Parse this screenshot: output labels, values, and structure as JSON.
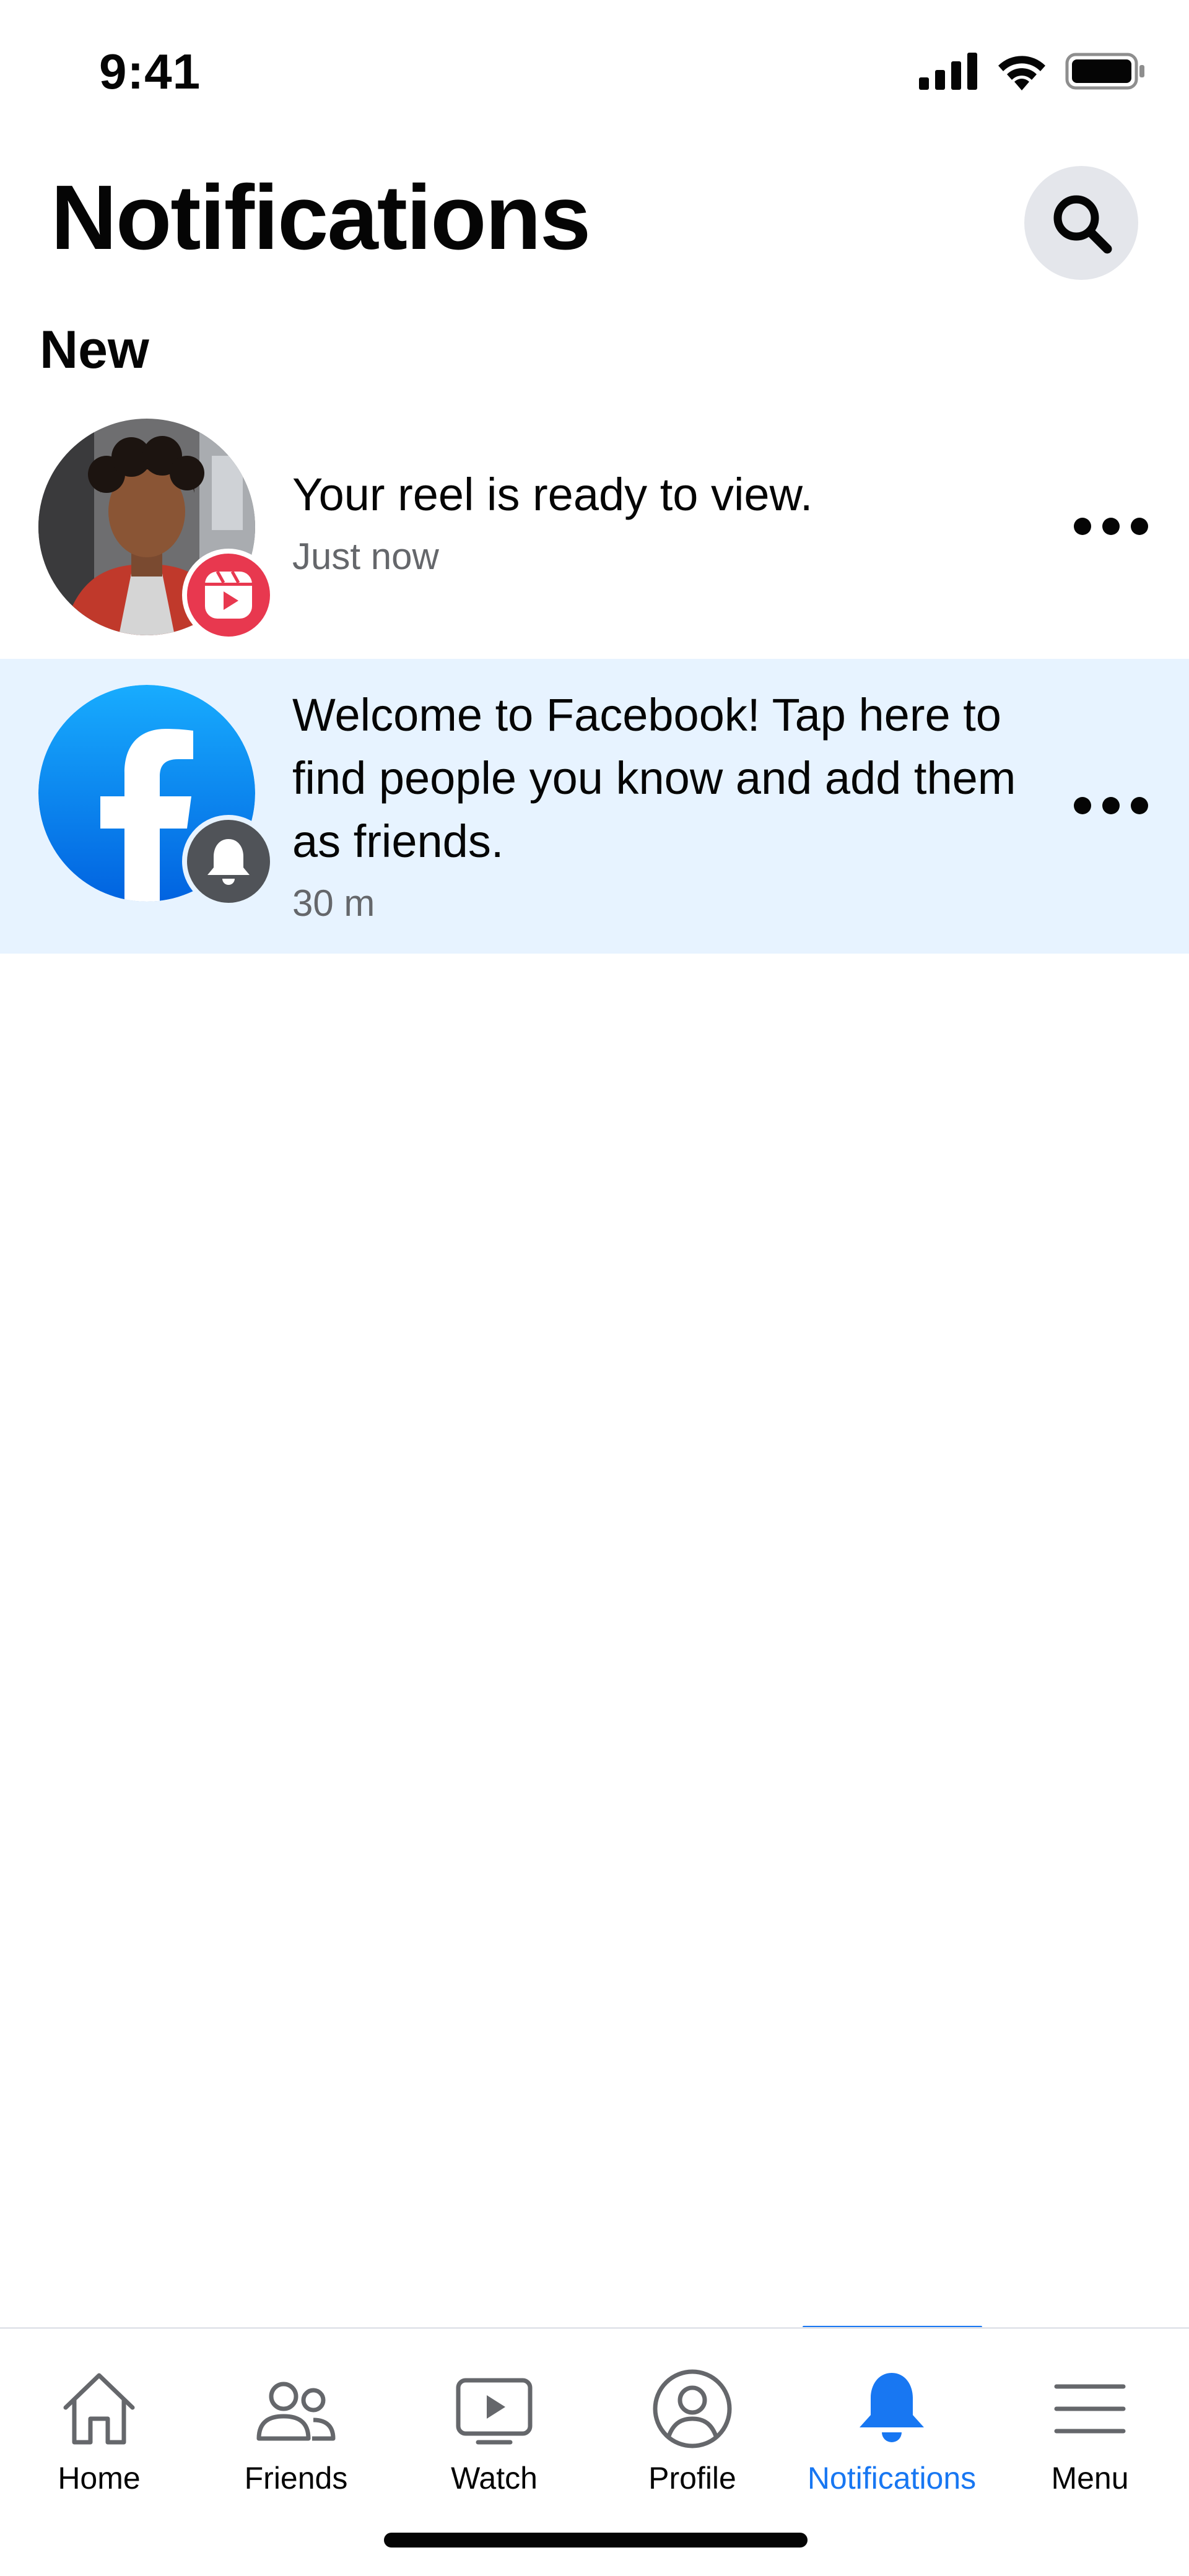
{
  "status_bar": {
    "time": "9:41"
  },
  "header": {
    "title": "Notifications"
  },
  "section": {
    "label": "New"
  },
  "notifications": [
    {
      "message": "Your reel is ready to view.",
      "time": "Just now",
      "avatar": "profile-photo",
      "badge": "reels-icon",
      "badge_color": "#e8384f",
      "unread": false
    },
    {
      "message": "Welcome to Facebook! Tap here to find people you know and add them as friends.",
      "time": "30 m",
      "avatar": "facebook-logo",
      "badge": "bell-icon",
      "badge_color": "#505358",
      "unread": true,
      "background": "#e7f3ff"
    }
  ],
  "tabs": [
    {
      "label": "Home",
      "icon": "home-icon"
    },
    {
      "label": "Friends",
      "icon": "friends-icon"
    },
    {
      "label": "Watch",
      "icon": "watch-icon"
    },
    {
      "label": "Profile",
      "icon": "profile-icon"
    },
    {
      "label": "Notifications",
      "icon": "bell-icon",
      "active": true
    },
    {
      "label": "Menu",
      "icon": "menu-icon"
    }
  ],
  "colors": {
    "accent": "#1877f2",
    "secondary_text": "#65676b"
  }
}
